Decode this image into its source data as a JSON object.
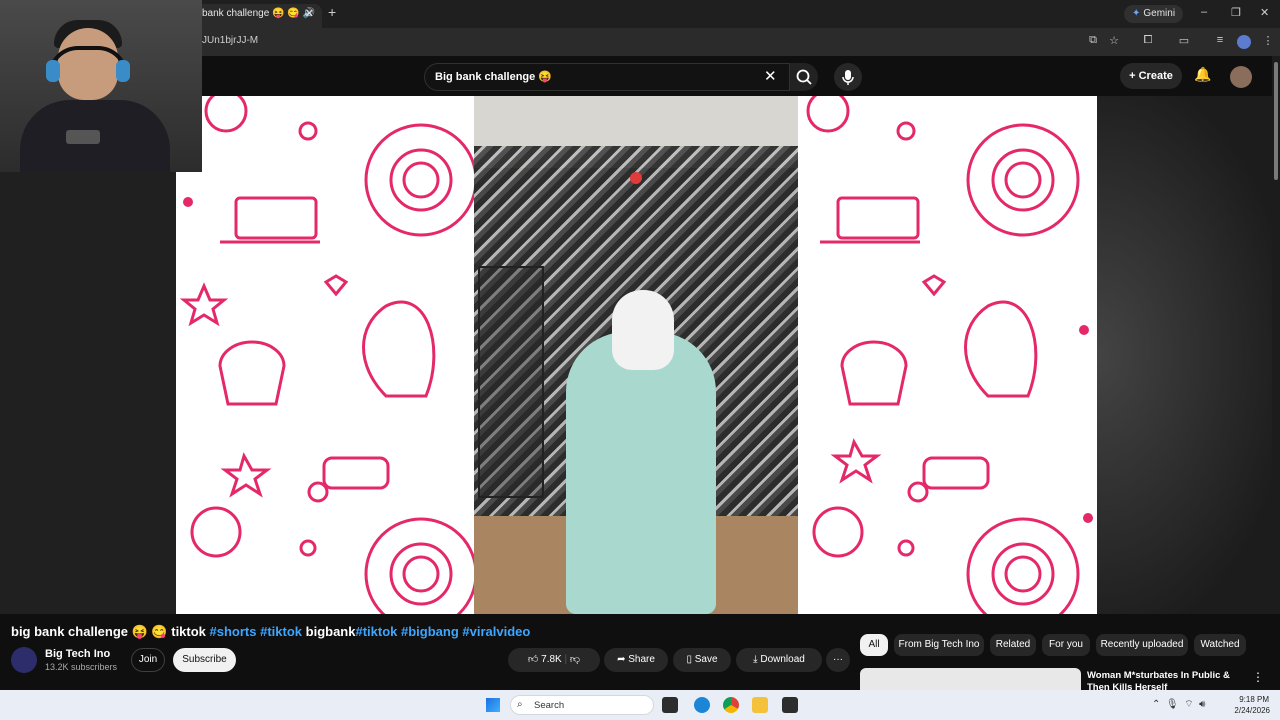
{
  "browser": {
    "tab_title": "bank challenge 😝 😋 🔊",
    "tab_close": "✕",
    "new_tab": "+",
    "gemini_label": "Gemini",
    "url": "JUn1bjrJJ-M",
    "window_controls": [
      "–",
      "❐",
      "✕"
    ]
  },
  "youtube_header": {
    "search_value": "Big bank challenge 😝",
    "search_clear": "✕",
    "create_label": "Create"
  },
  "video": {
    "title_prefix": "big bank challenge 😝 😋 tiktok ",
    "hashtag_shorts": "#shorts",
    "hashtag_tiktok": "#tiktok",
    "word_bigbank": " bigbank",
    "hashtag_tiktok2": "#tiktok",
    "hashtag_bigbang": "#bigbang",
    "hashtag_viralvideo": "#viralvideo"
  },
  "channel": {
    "name": "Big Tech Ino",
    "subscribers": "13.2K subscribers",
    "join_label": "Join",
    "subscribe_label": "Subscribe"
  },
  "actions": {
    "like_count": "7.8K",
    "share_label": "Share",
    "save_label": "Save",
    "download_label": "Download",
    "more_label": "···"
  },
  "chips": [
    "All",
    "From Big Tech Ino",
    "Related",
    "For you",
    "Recently uploaded",
    "Watched"
  ],
  "recommendation": {
    "title": "Woman M*sturbates In Public & Then Kills Herself",
    "more": "⋮"
  },
  "taskbar": {
    "search_placeholder": "Search",
    "time": "9:18 PM",
    "date": "2/24/2026"
  },
  "colors": {
    "accent_link": "#3ea6ff",
    "pattern_pink": "#e4286a"
  }
}
